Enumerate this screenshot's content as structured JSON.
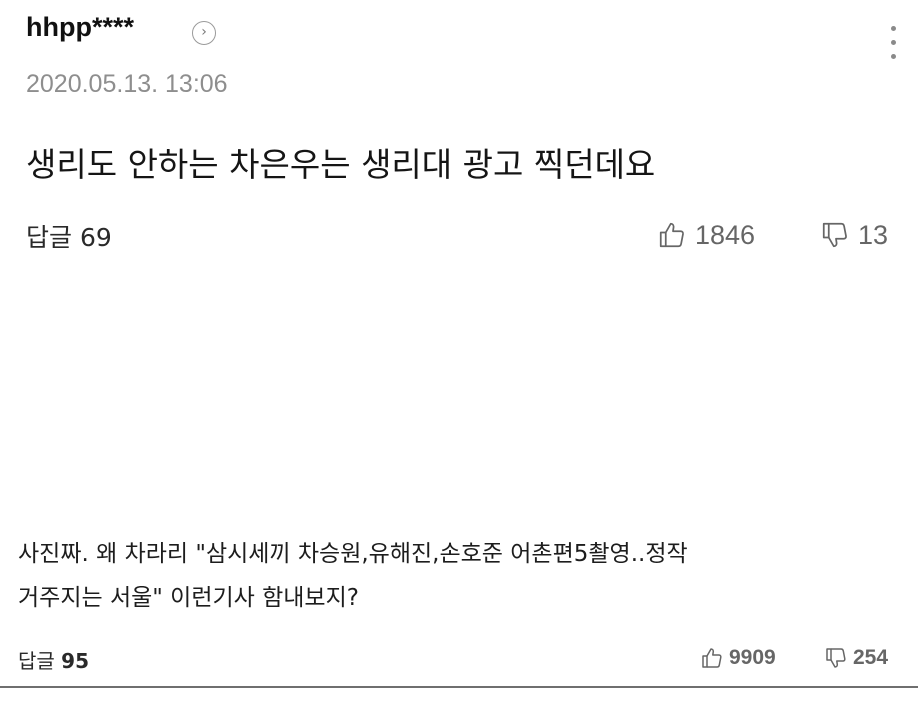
{
  "comment1": {
    "username": "hhpp****",
    "timestamp": "2020.05.13. 13:06",
    "body": "생리도 안하는 차은우는 생리대 광고 찍던데요",
    "reply_label": "답글",
    "reply_count": "69",
    "likes": "1846",
    "dislikes": "13"
  },
  "comment2": {
    "body_line1": "사진짜. 왜 차라리 \"삼시세끼 차승원,유해진,손호준 어촌편5촬영..정작",
    "body_line2": "거주지는 서울\" 이런기사 함내보지?",
    "reply_label": "답글",
    "reply_count": "95",
    "likes": "9909",
    "dislikes": "254"
  },
  "icons": {
    "profile": "chevron-right-circle-icon",
    "more": "more-vertical-icon",
    "like": "thumbs-up-icon",
    "dislike": "thumbs-down-icon"
  }
}
